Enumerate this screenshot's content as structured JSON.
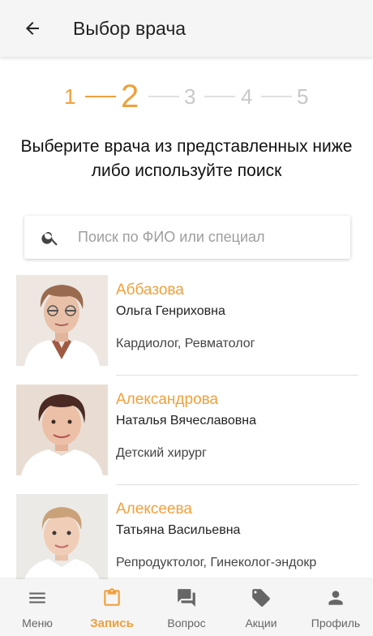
{
  "header": {
    "back_icon": "arrow-back-icon",
    "title": "Выбор врача"
  },
  "stepper": {
    "current": 2,
    "steps": [
      "1",
      "2",
      "3",
      "4",
      "5"
    ]
  },
  "heading": "Выберите врача из представленных ниже либо используйте поиск",
  "search": {
    "icon": "search-icon",
    "placeholder": "Поиск по ФИО или специал",
    "value": ""
  },
  "doctors": [
    {
      "surname": "Аббазова",
      "name": "Ольга Генриховна",
      "specialty": "Кардиолог, Ревматолог"
    },
    {
      "surname": "Александрова",
      "name": "Наталья Вячеславовна",
      "specialty": "Детский хирург"
    },
    {
      "surname": "Алексеева",
      "name": "Татьяна Васильевна",
      "specialty": "Репродуктолог, Гинеколог-эндокр"
    }
  ],
  "bottom_nav": [
    {
      "label": "Меню",
      "icon": "menu-icon",
      "active": false
    },
    {
      "label": "Запись",
      "icon": "clipboard-icon",
      "active": true
    },
    {
      "label": "Вопрос",
      "icon": "chat-icon",
      "active": false
    },
    {
      "label": "Акции",
      "icon": "tag-icon",
      "active": false
    },
    {
      "label": "Профиль",
      "icon": "person-icon",
      "active": false
    }
  ],
  "colors": {
    "accent": "#f0a03c",
    "step_inactive": "#c8c8c8",
    "bar_background": "#f5f5f5"
  }
}
